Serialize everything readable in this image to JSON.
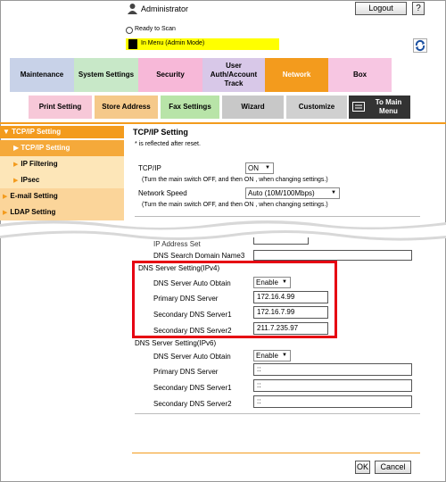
{
  "header": {
    "admin_label": "Administrator",
    "logout_label": "Logout",
    "help_label": "?",
    "status_text": "Ready to Scan",
    "mode_text": "In Menu (Admin Mode)"
  },
  "tabs_row1": [
    "Maintenance",
    "System Settings",
    "Security",
    "User Auth/Account Track",
    "Network",
    "Box"
  ],
  "tabs_row2": [
    "Print Setting",
    "Store Address",
    "Fax Settings",
    "Wizard",
    "Customize",
    "To Main Menu"
  ],
  "nav": {
    "head": "TCP/IP Setting",
    "items": [
      "TCP/IP Setting",
      "IP Filtering",
      "IPsec",
      "E-mail Setting",
      "LDAP Setting"
    ]
  },
  "content": {
    "title": "TCP/IP Setting",
    "note": "* is reflected after reset.",
    "tcpip_label": "TCP/IP",
    "tcpip_value": "ON",
    "tcpip_hint": "(Turn the main switch OFF, and then ON , when changing settings.)",
    "speed_label": "Network Speed",
    "speed_value": "Auto (10M/100Mbps)",
    "speed_hint": "(Turn the main switch OFF, and then ON , when changing settings.)",
    "ip_addr_partial": "IP Address Set",
    "dns_domain3": "DNS Search Domain Name3",
    "ipv4_group": "DNS Server Setting(IPv4)",
    "ipv4_auto_label": "DNS Server Auto Obtain",
    "ipv4_auto_value": "Enable",
    "ipv4_primary_label": "Primary DNS Server",
    "ipv4_primary_value": "172.16.4.99",
    "ipv4_sec1_label": "Secondary DNS Server1",
    "ipv4_sec1_value": "172.16.7.99",
    "ipv4_sec2_label": "Secondary DNS Server2",
    "ipv4_sec2_value": "211.7.235.97",
    "ipv6_group": "DNS Server Setting(IPv6)",
    "ipv6_auto_label": "DNS Server Auto Obtain",
    "ipv6_auto_value": "Enable",
    "ipv6_primary_label": "Primary DNS Server",
    "ipv6_primary_value": "::",
    "ipv6_sec1_label": "Secondary DNS Server1",
    "ipv6_sec1_value": "::",
    "ipv6_sec2_label": "Secondary DNS Server2",
    "ipv6_sec2_value": "::"
  },
  "footer": {
    "ok_label": "OK",
    "cancel_label": "Cancel"
  },
  "colors": {
    "accent": "#f39b1d",
    "highlight": "#e60012",
    "mode_bar": "#ffff00"
  },
  "icons": [
    "admin-icon",
    "mode-icon",
    "refresh-icon",
    "tcpip-nav-icon",
    "menu-icon"
  ]
}
